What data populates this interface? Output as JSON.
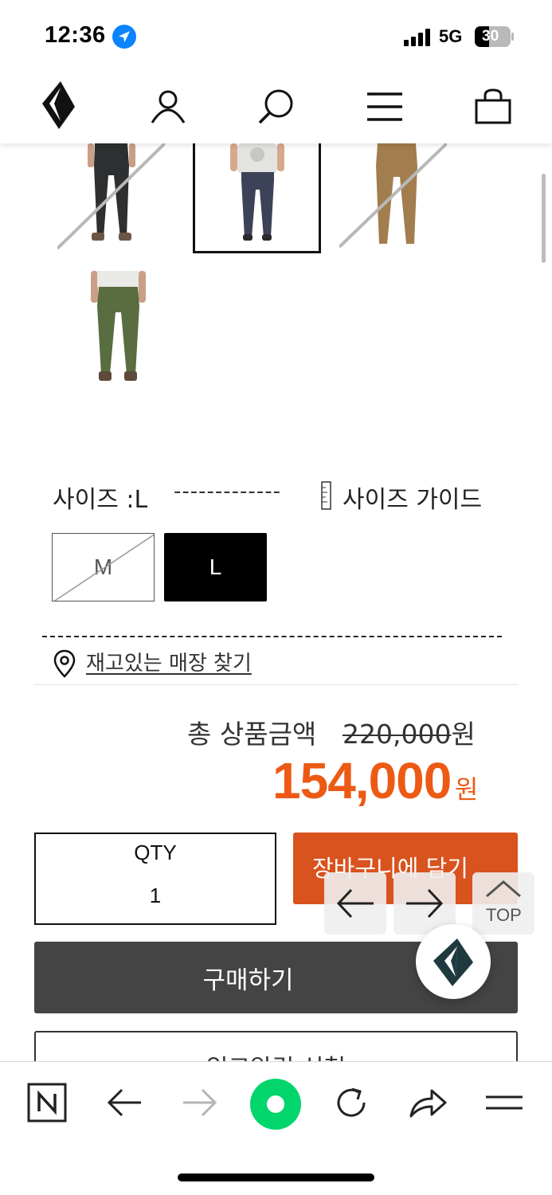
{
  "status_bar": {
    "time": "12:36",
    "network": "5G",
    "battery": "30"
  },
  "header": {
    "icons": [
      "brand-logo-icon",
      "account-icon",
      "search-icon",
      "menu-icon",
      "shopping-bag-icon"
    ]
  },
  "swatches": [
    {
      "name": "black-pants",
      "sold_out": true
    },
    {
      "name": "navy-pants",
      "sold_out": false,
      "selected": true
    },
    {
      "name": "khaki-pants",
      "sold_out": true
    },
    {
      "name": "olive-pants",
      "sold_out": false
    }
  ],
  "size": {
    "label": "사이즈 :L",
    "dash": "-------------",
    "guide_label": "사이즈 가이드",
    "options": [
      {
        "label": "M",
        "disabled": true
      },
      {
        "label": "L",
        "selected": true
      }
    ]
  },
  "store_finder": {
    "label": "재고있는 매장 찾기"
  },
  "price": {
    "total_label": "총 상품금액",
    "original_num": "220,000",
    "original_unit": "원",
    "sale": "154,000",
    "sale_unit": "원"
  },
  "order": {
    "qty_label": "QTY",
    "qty_value": "1",
    "cart_button": "장바구니에 담기",
    "buy_button": "구매하기",
    "restock_button": "입고알림 신청"
  },
  "float_nav": {
    "top_label": "TOP"
  },
  "colors": {
    "accent_orange": "#ec5a14",
    "cart_button": "#d9531e",
    "buy_button": "#444444"
  },
  "browser_toolbar": {
    "icons": [
      "naver-n-icon",
      "back-arrow-icon",
      "forward-arrow-icon",
      "green-home-icon",
      "reload-icon",
      "share-icon",
      "menu-icon"
    ]
  }
}
